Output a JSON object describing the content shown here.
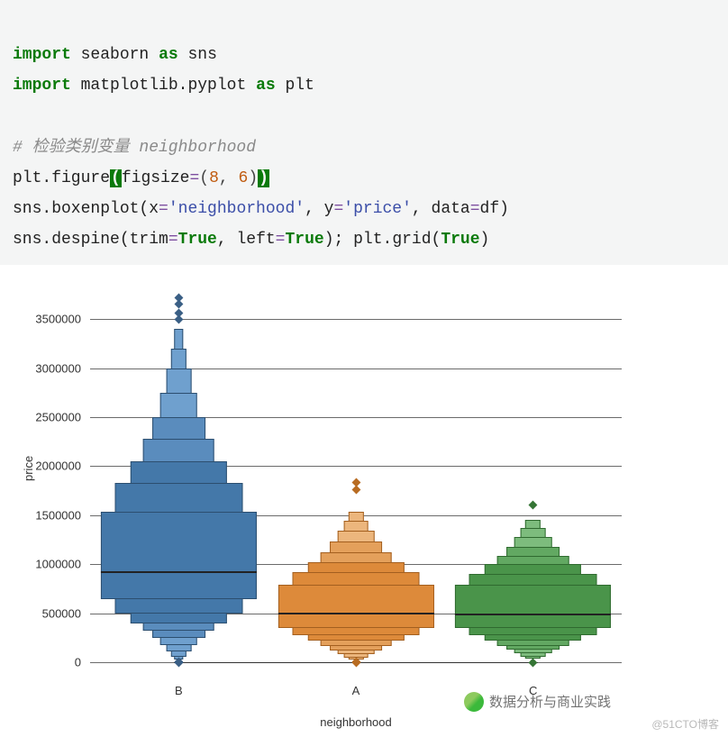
{
  "code": {
    "line1_kw1": "import",
    "line1_mod": "seaborn",
    "line1_kw2": "as",
    "line1_alias": "sns",
    "line2_kw1": "import",
    "line2_mod": "matplotlib.pyplot",
    "line2_kw2": "as",
    "line2_alias": "plt",
    "line4_comment": "# 检验类别变量 neighborhood",
    "line5_a": "plt.figure",
    "line5_op": "(",
    "line5_kw": "figsize",
    "line5_eq": "=",
    "line5_pa": "(",
    "line5_n1": "8",
    "line5_c": ", ",
    "line5_n2": "6",
    "line5_pb": ")",
    "line5_cl": ")",
    "line6_a": "sns.boxenplot(x",
    "line6_eq1": "=",
    "line6_s1": "'neighborhood'",
    "line6_b": ", y",
    "line6_eq2": "=",
    "line6_s2": "'price'",
    "line6_c": ", data",
    "line6_eq3": "=",
    "line6_d": "df)",
    "line7_a": "sns.despine(trim",
    "line7_eq1": "=",
    "line7_b1": "True",
    "line7_b": ", left",
    "line7_eq2": "=",
    "line7_b2": "True",
    "line7_c": "); plt.grid(",
    "line7_b3": "True",
    "line7_d": ")"
  },
  "chart_data": {
    "type": "boxen",
    "xlabel": "neighborhood",
    "ylabel": "price",
    "yticks": [
      0,
      500000,
      1000000,
      1500000,
      2000000,
      2500000,
      3000000,
      3500000
    ],
    "ylim": [
      -150000,
      3800000
    ],
    "categories": [
      "B",
      "A",
      "C"
    ],
    "series": [
      {
        "name": "B",
        "median": 920000,
        "levels": [
          {
            "lo": 640000,
            "hi": 1540000,
            "w": 1.0
          },
          {
            "lo": 500000,
            "hi": 1830000,
            "w": 0.82
          },
          {
            "lo": 400000,
            "hi": 2050000,
            "w": 0.62
          },
          {
            "lo": 320000,
            "hi": 2280000,
            "w": 0.46
          },
          {
            "lo": 250000,
            "hi": 2500000,
            "w": 0.34
          },
          {
            "lo": 180000,
            "hi": 2750000,
            "w": 0.24
          },
          {
            "lo": 110000,
            "hi": 3000000,
            "w": 0.16
          },
          {
            "lo": 60000,
            "hi": 3200000,
            "w": 0.1
          },
          {
            "lo": 30000,
            "hi": 3400000,
            "w": 0.06
          }
        ],
        "outliers": [
          0,
          10000,
          3500000,
          3560000,
          3650000,
          3720000
        ]
      },
      {
        "name": "A",
        "median": 500000,
        "levels": [
          {
            "lo": 350000,
            "hi": 790000,
            "w": 1.0
          },
          {
            "lo": 280000,
            "hi": 920000,
            "w": 0.82
          },
          {
            "lo": 220000,
            "hi": 1020000,
            "w": 0.62
          },
          {
            "lo": 170000,
            "hi": 1120000,
            "w": 0.46
          },
          {
            "lo": 120000,
            "hi": 1230000,
            "w": 0.34
          },
          {
            "lo": 80000,
            "hi": 1340000,
            "w": 0.24
          },
          {
            "lo": 50000,
            "hi": 1440000,
            "w": 0.16
          },
          {
            "lo": 30000,
            "hi": 1540000,
            "w": 0.1
          }
        ],
        "outliers": [
          0,
          5000,
          1760000,
          1830000
        ]
      },
      {
        "name": "C",
        "median": 490000,
        "levels": [
          {
            "lo": 350000,
            "hi": 790000,
            "w": 1.0
          },
          {
            "lo": 280000,
            "hi": 900000,
            "w": 0.82
          },
          {
            "lo": 220000,
            "hi": 1000000,
            "w": 0.62
          },
          {
            "lo": 170000,
            "hi": 1090000,
            "w": 0.46
          },
          {
            "lo": 130000,
            "hi": 1180000,
            "w": 0.34
          },
          {
            "lo": 90000,
            "hi": 1280000,
            "w": 0.24
          },
          {
            "lo": 60000,
            "hi": 1370000,
            "w": 0.16
          },
          {
            "lo": 35000,
            "hi": 1450000,
            "w": 0.1
          }
        ],
        "outliers": [
          0,
          1600000
        ]
      }
    ]
  },
  "watermark": {
    "source": "@51CTO博客",
    "account": "数据分析与商业实践"
  }
}
